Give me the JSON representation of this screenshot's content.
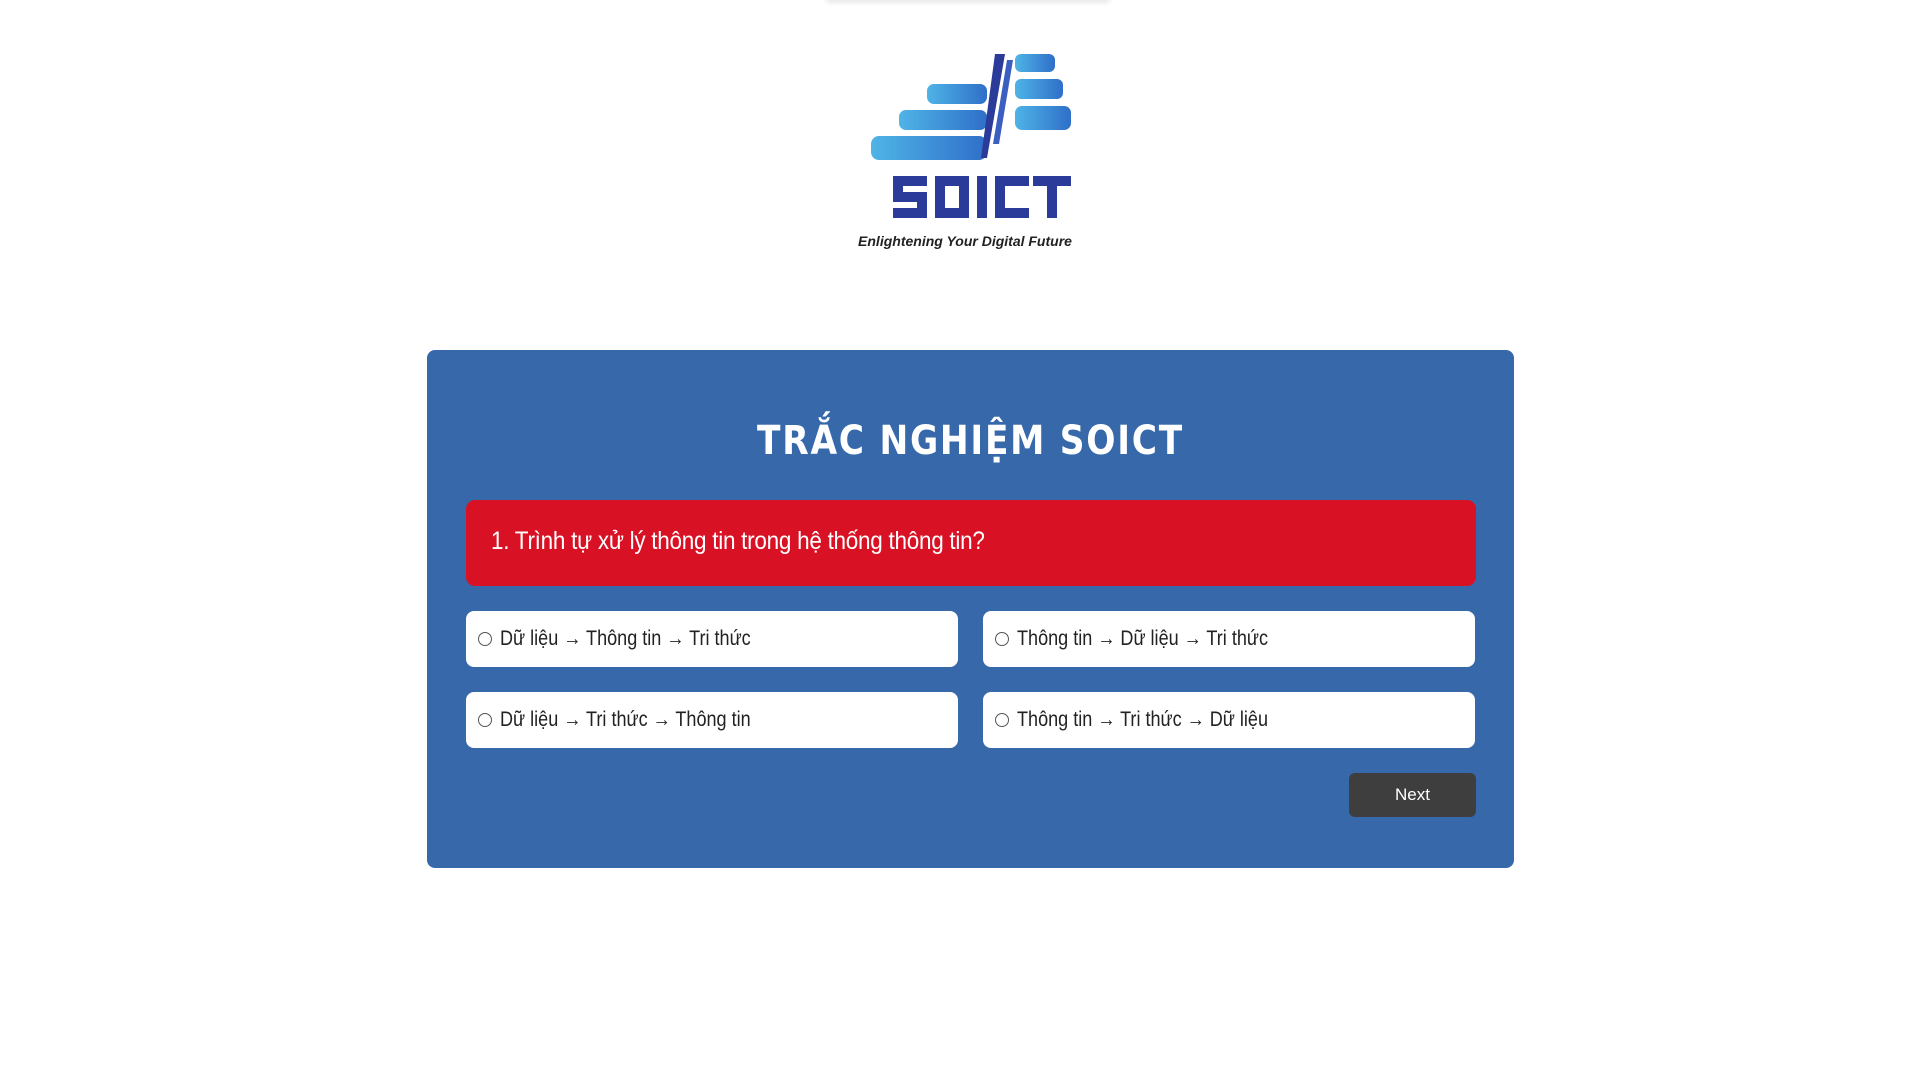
{
  "logo": {
    "name": "SOICT",
    "tagline": "Enlightening Your Digital Future"
  },
  "quiz": {
    "title": "TRẮC NGHIỆM SOICT",
    "question": "1. Trình tự xử lý thông tin trong hệ thống thông tin?",
    "options": [
      "Dữ liệu → Thông tin → Tri thức",
      "Thông tin → Dữ liệu → Tri thức",
      "Dữ liệu → Tri thức → Thông tin",
      "Thông tin → Tri thức → Dữ liệu"
    ],
    "next_label": "Next"
  },
  "colors": {
    "card": "#3668aa",
    "question_bg": "#d81224",
    "button": "#3e3e3e",
    "logo_blue": "#2a3b9a",
    "logo_light_blue": "#3b9ed8"
  }
}
